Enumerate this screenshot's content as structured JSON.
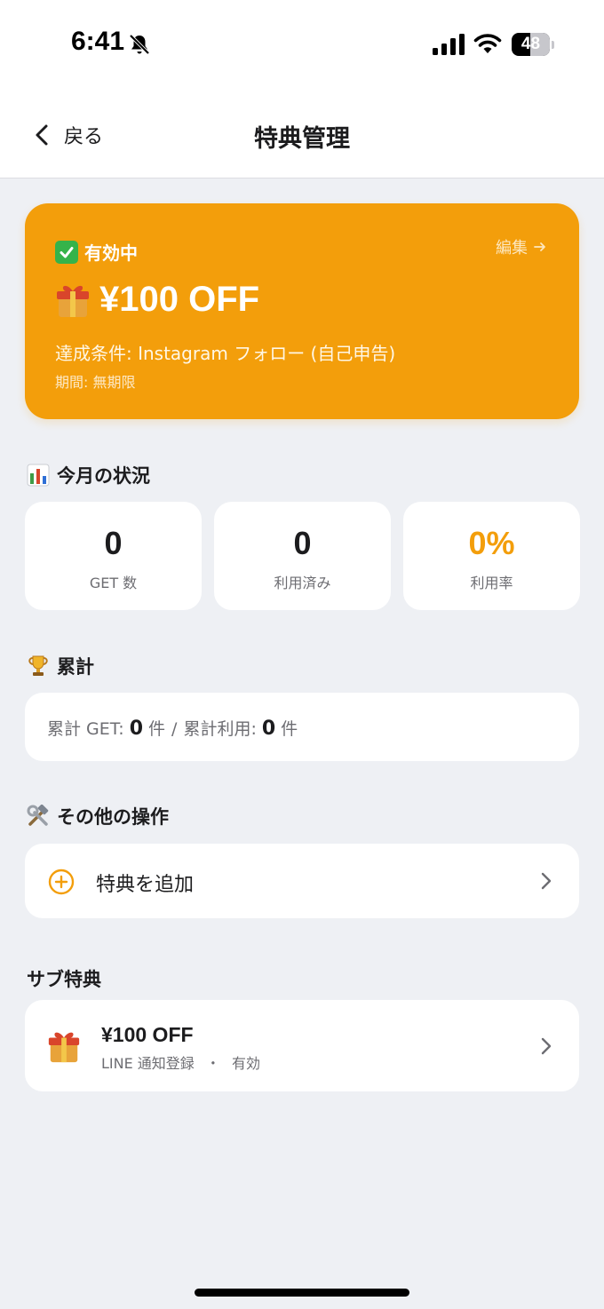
{
  "status_bar": {
    "time": "6:41",
    "battery_level": "48",
    "battery_fraction": 0.48
  },
  "nav": {
    "back_label": "戻る",
    "title": "特典管理"
  },
  "hero": {
    "status_label": "有効中",
    "edit_label": "編集",
    "title": "¥100 OFF",
    "condition": "達成条件: Instagram フォロー (自己申告)",
    "period": "期間: 無期限",
    "background_color": "#f39e0b"
  },
  "monthly": {
    "heading": "今月の状況",
    "stats": [
      {
        "value": "0",
        "label": "GET 数"
      },
      {
        "value": "0",
        "label": "利用済み"
      },
      {
        "value": "0%",
        "label": "利用率"
      }
    ],
    "rate_color": "#f39e0b"
  },
  "totals": {
    "heading": "累計",
    "get_prefix": "累計 GET:",
    "get_count": "0",
    "unit": "件",
    "separator": "/",
    "use_prefix": "累計利用:",
    "use_count": "0"
  },
  "other_actions": {
    "heading": "その他の操作",
    "add_label": "特典を追加"
  },
  "sub_benefits": {
    "heading": "サブ特典",
    "items": [
      {
        "title": "¥100 OFF",
        "condition": "LINE 通知登録",
        "dot": "・",
        "status": "有効"
      }
    ]
  },
  "icons": {
    "back": "chevron-left-icon",
    "check": "check-box-icon",
    "gift": "gift-icon",
    "chart": "bar-chart-icon",
    "trophy": "trophy-icon",
    "tools": "hammer-wrench-icon",
    "add": "plus-circle-icon",
    "chevron": "chevron-right-icon"
  }
}
